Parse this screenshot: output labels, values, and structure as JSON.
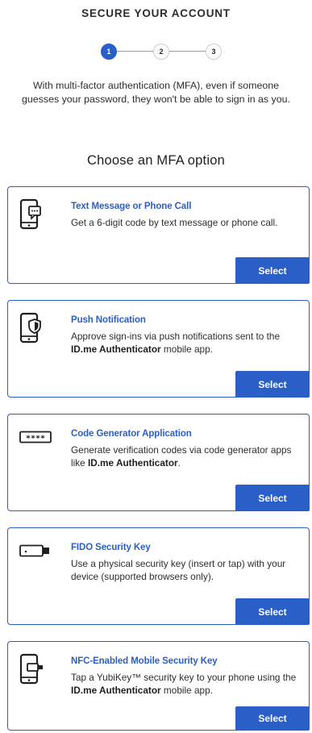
{
  "header": {
    "title": "SECURE YOUR ACCOUNT"
  },
  "stepper": {
    "steps": [
      "1",
      "2",
      "3"
    ],
    "current": 1
  },
  "intro": {
    "text": "With multi-factor authentication (MFA), even if someone guesses your password, they won't be able to sign in as you."
  },
  "section": {
    "title": "Choose an MFA option"
  },
  "colors": {
    "accent": "#2a5fc7",
    "text": "#2d2d2d"
  },
  "options": [
    {
      "icon": "phone-message-icon",
      "title": "Text Message or Phone Call",
      "desc_pre": "Get a 6-digit code by text message or phone call.",
      "desc_bold": "",
      "desc_post": "",
      "button": "Select"
    },
    {
      "icon": "phone-shield-icon",
      "title": "Push Notification",
      "desc_pre": "Approve sign-ins via push notifications sent to the ",
      "desc_bold": "ID.me Authenticator",
      "desc_post": " mobile app.",
      "button": "Select"
    },
    {
      "icon": "code-generator-icon",
      "title": "Code Generator Application",
      "desc_pre": "Generate verification codes via code generator apps like ",
      "desc_bold": "ID.me Authenticator",
      "desc_post": ".",
      "button": "Select"
    },
    {
      "icon": "security-key-icon",
      "title": "FIDO Security Key",
      "desc_pre": "Use a physical security key (insert or tap) with your device (supported browsers only).",
      "desc_bold": "",
      "desc_post": "",
      "button": "Select"
    },
    {
      "icon": "nfc-phone-key-icon",
      "title": "NFC-Enabled Mobile Security Key",
      "desc_pre": "Tap a YubiKey™ security key to your phone using the ",
      "desc_bold": "ID.me Authenticator",
      "desc_post": " mobile app.",
      "button": "Select"
    }
  ]
}
